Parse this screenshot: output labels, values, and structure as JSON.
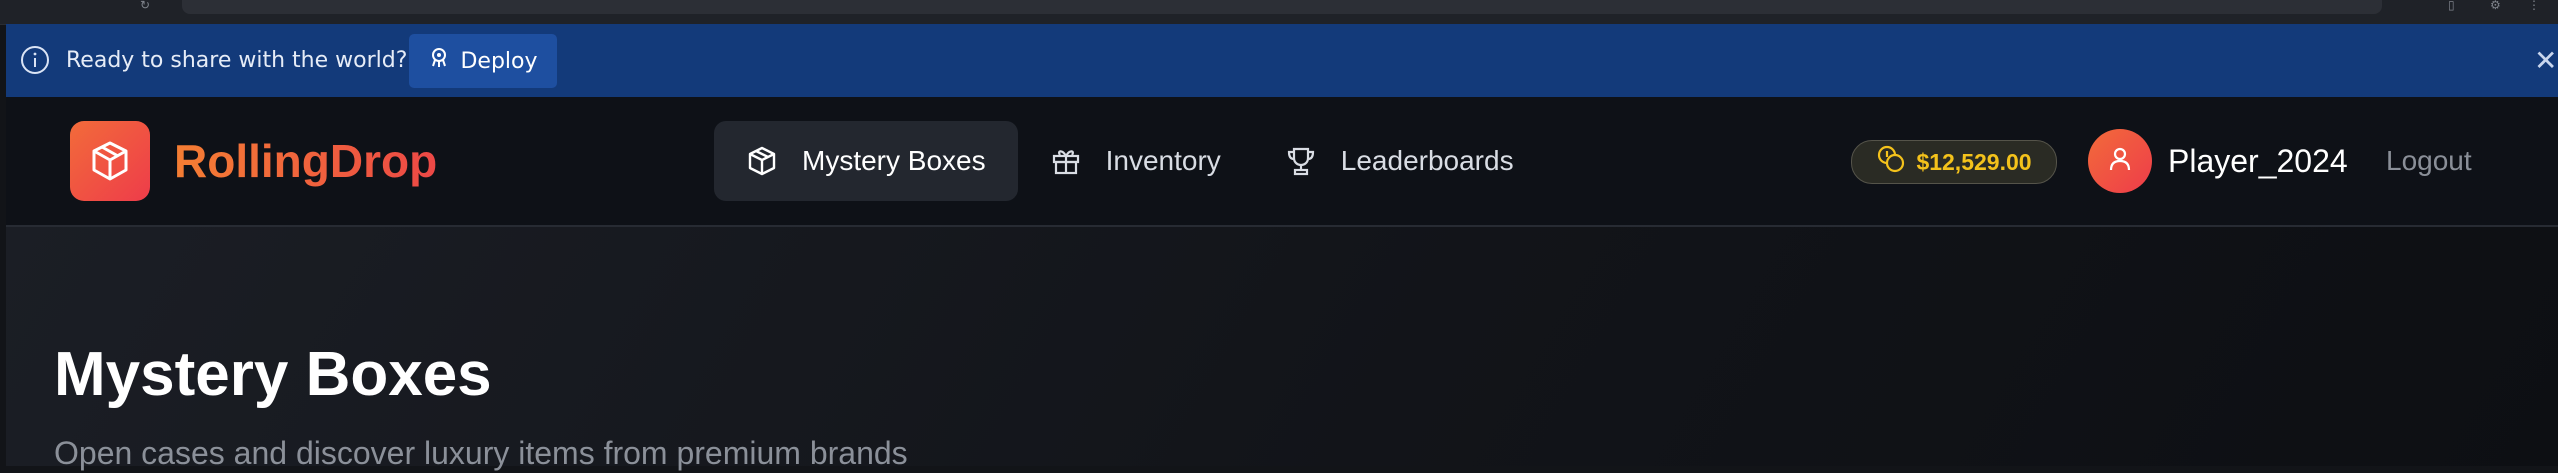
{
  "banner": {
    "message": "Ready to share with the world?",
    "deploy_label": "Deploy",
    "info_icon": "info-circle-icon",
    "close_icon": "close-icon",
    "background": "#133a7a"
  },
  "brand": {
    "name": "RollingDrop",
    "logo_icon": "box-icon",
    "accent_from": "#f26b3a",
    "accent_to": "#ee3c4a"
  },
  "nav": {
    "items": [
      {
        "label": "Mystery Boxes",
        "icon": "box-icon",
        "active": true
      },
      {
        "label": "Inventory",
        "icon": "gift-icon",
        "active": false
      },
      {
        "label": "Leaderboards",
        "icon": "trophy-icon",
        "active": false
      }
    ]
  },
  "user": {
    "balance": "$12,529.00",
    "balance_icon": "coins-icon",
    "balance_color": "#f4c21b",
    "avatar_icon": "user-icon",
    "username": "Player_2024",
    "logout_label": "Logout"
  },
  "page": {
    "title": "Mystery Boxes",
    "subtitle": "Open cases and discover luxury items from premium brands"
  }
}
